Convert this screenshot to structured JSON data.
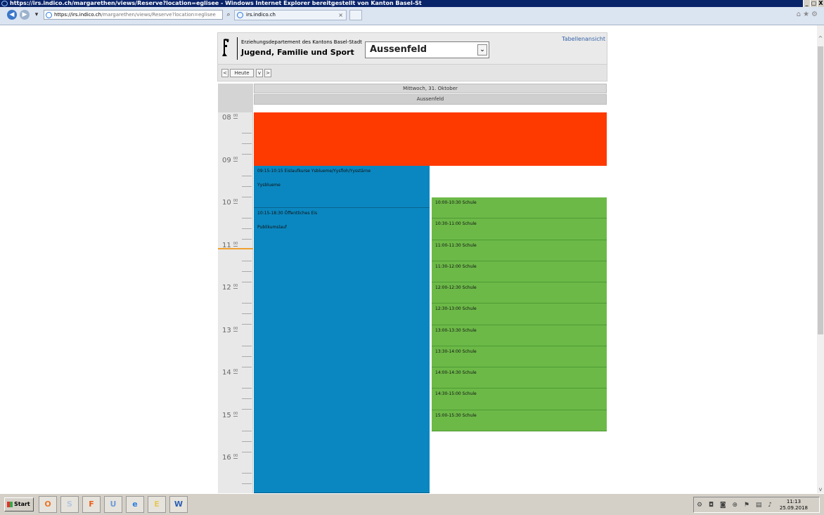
{
  "window": {
    "title": "https://irs.indico.ch/margarethen/views/Reserve?location=eglisee - Windows Internet Explorer bereitgestellt von Kanton Basel-St",
    "controls": [
      "_",
      "▢",
      "X"
    ]
  },
  "browser": {
    "address_host": "https://irs.indico.ch",
    "address_path": "/margarethen/views/Reserve?location=eglisee",
    "tab_label": "irs.indico.ch"
  },
  "header": {
    "org_small": "Erziehungsdepartement des Kantons Basel-Stadt",
    "org_big": "Jugend, Familie und Sport",
    "location_selected": "Aussenfeld",
    "table_view_link": "Tabellenansicht"
  },
  "nav": {
    "prev": "<",
    "today": "Heute",
    "dropdown": "v",
    "next": ">"
  },
  "calendar": {
    "day_label": "Mittwoch, 31. Oktober",
    "resource_label": "Aussenfeld",
    "hours": [
      {
        "h": "08",
        "m": "00"
      },
      {
        "h": "09",
        "m": "00"
      },
      {
        "h": "10",
        "m": "00"
      },
      {
        "h": "11",
        "m": "00"
      },
      {
        "h": "12",
        "m": "00"
      },
      {
        "h": "13",
        "m": "00"
      },
      {
        "h": "14",
        "m": "00"
      },
      {
        "h": "15",
        "m": "00"
      },
      {
        "h": "16",
        "m": "00"
      }
    ],
    "blocked_color": "#ff3a00",
    "public_color": "#0a87c0",
    "school_color": "#6cb948",
    "events_blue": [
      {
        "time": "09:15-10:15 Eislaufkurse Ysblueme/Yysfloh/Yysstärne",
        "sub": "Yysblueme"
      },
      {
        "time": "10:15-18:30 Öffentliches Eis",
        "sub": "Publikumslauf"
      }
    ],
    "events_green": [
      "10:00-10:30 Schule",
      "10:30-11:00 Schule",
      "11:00-11:30 Schule",
      "11:30-12:00 Schule",
      "12:00-12:30 Schule",
      "12:30-13:00 Schule",
      "13:00-13:30 Schule",
      "13:30-14:00 Schule",
      "14:00-14:30 Schule",
      "14:30-15:00 Schule",
      "15:00-15:30 Schule"
    ]
  },
  "taskbar": {
    "start_label": "Start",
    "apps": [
      "O",
      "S",
      "F",
      "U",
      "e",
      "E",
      "W"
    ],
    "time": "11:13",
    "date": "25.09.2018"
  }
}
